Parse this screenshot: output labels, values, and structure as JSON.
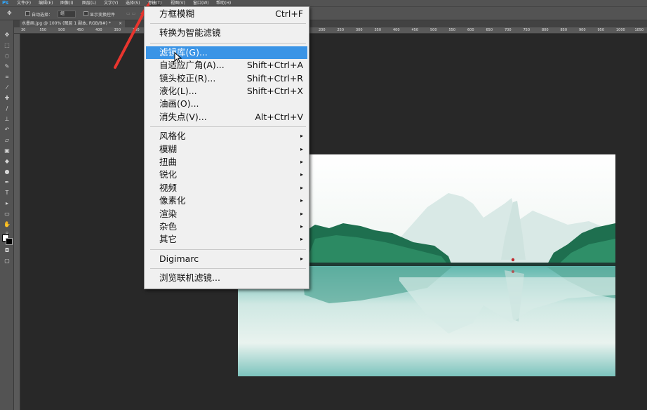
{
  "app": {
    "logo": "Ps"
  },
  "menubar": {
    "items": [
      {
        "label": "文件(F)"
      },
      {
        "label": "编辑(E)"
      },
      {
        "label": "图像(I)"
      },
      {
        "label": "图层(L)"
      },
      {
        "label": "文字(Y)"
      },
      {
        "label": "选择(S)"
      },
      {
        "label": "滤镜(T)",
        "active": true
      },
      {
        "label": "视图(V)"
      },
      {
        "label": "窗口(W)"
      },
      {
        "label": "帮助(H)"
      }
    ]
  },
  "options": {
    "auto_select_label": "自动选择：",
    "auto_select_value": "组",
    "show_transform_label": "显示变换控件"
  },
  "document": {
    "tab_title": "水墨画.jpg @ 100% (图层 1 副本, RGB/8#) *",
    "close_glyph": "×"
  },
  "ruler": {
    "ticks": [
      "30",
      "550",
      "500",
      "450",
      "400",
      "350",
      "300",
      "250",
      "200",
      "150",
      "100",
      "50",
      "0",
      "50",
      "100",
      "150",
      "200",
      "250",
      "300",
      "350",
      "400",
      "450",
      "500",
      "550",
      "600",
      "650",
      "700",
      "750",
      "800",
      "850",
      "900",
      "950",
      "1000",
      "1050"
    ]
  },
  "filter_menu": {
    "groups": [
      [
        {
          "label": "方框模糊",
          "shortcut": "Ctrl+F"
        }
      ],
      [
        {
          "label": "转换为智能滤镜"
        }
      ],
      [
        {
          "label": "滤镜库(G)...",
          "highlighted": true
        },
        {
          "label": "自适应广角(A)...",
          "shortcut": "Shift+Ctrl+A"
        },
        {
          "label": "镜头校正(R)...",
          "shortcut": "Shift+Ctrl+R"
        },
        {
          "label": "液化(L)...",
          "shortcut": "Shift+Ctrl+X"
        },
        {
          "label": "油画(O)..."
        },
        {
          "label": "消失点(V)...",
          "shortcut": "Alt+Ctrl+V"
        }
      ],
      [
        {
          "label": "风格化",
          "submenu": true
        },
        {
          "label": "模糊",
          "submenu": true
        },
        {
          "label": "扭曲",
          "submenu": true
        },
        {
          "label": "锐化",
          "submenu": true
        },
        {
          "label": "视频",
          "submenu": true
        },
        {
          "label": "像素化",
          "submenu": true
        },
        {
          "label": "渲染",
          "submenu": true
        },
        {
          "label": "杂色",
          "submenu": true
        },
        {
          "label": "其它",
          "submenu": true
        }
      ],
      [
        {
          "label": "Digimarc",
          "submenu": true
        }
      ],
      [
        {
          "label": "浏览联机滤镜..."
        }
      ]
    ],
    "submenu_glyph": "▸"
  },
  "colors": {
    "menu_highlight": "#3a94e6",
    "annotation_arrow": "#e8352e",
    "workspace": "#282828"
  }
}
